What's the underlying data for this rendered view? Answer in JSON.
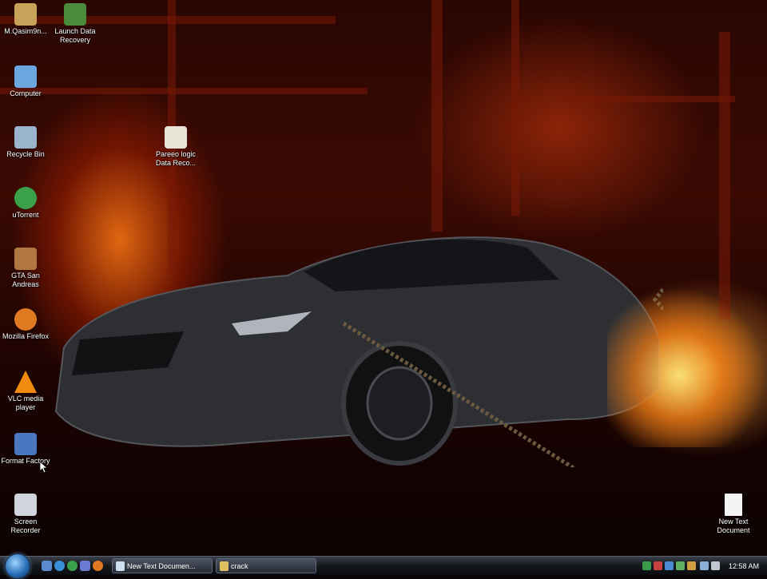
{
  "desktop": {
    "icons": [
      {
        "label": "M.Qasim9n...",
        "icon": "folder-icon",
        "color": "#c8a45a"
      },
      {
        "label": "Launch Data Recovery",
        "icon": "recovery-icon",
        "color": "#4a8a3a"
      },
      {
        "label": "Computer",
        "icon": "computer-icon",
        "color": "#6aa6e0"
      },
      {
        "label": "Recycle Bin",
        "icon": "recycle-bin-icon",
        "color": "#9ab4cc"
      },
      {
        "label": "Pareeo logic Data Reco...",
        "icon": "document-icon",
        "color": "#e8e4d8"
      },
      {
        "label": "uTorrent",
        "icon": "utorrent-icon",
        "color": "#3aa04a"
      },
      {
        "label": "GTA San Andreas",
        "icon": "gta-icon",
        "color": "#b07840"
      },
      {
        "label": "Mozilla Firefox",
        "icon": "firefox-icon",
        "color": "#e07a20"
      },
      {
        "label": "VLC media player",
        "icon": "vlc-icon",
        "color": "#f08a10"
      },
      {
        "label": "Format Factory",
        "icon": "format-factory-icon",
        "color": "#4a78c0"
      },
      {
        "label": "Screen Recorder",
        "icon": "screen-recorder-icon",
        "color": "#d0d4dc"
      },
      {
        "label": "New Text Document",
        "icon": "text-document-icon",
        "color": "#f4f4f4"
      }
    ]
  },
  "taskbar": {
    "quick_launch": [
      {
        "icon": "show-desktop-icon",
        "color": "#5a8ad0"
      },
      {
        "icon": "ie-icon",
        "color": "#3a90d8"
      },
      {
        "icon": "utorrent-icon",
        "color": "#3aa04a"
      },
      {
        "icon": "media-icon",
        "color": "#6a7ad0"
      },
      {
        "icon": "firefox-icon",
        "color": "#e07a20"
      }
    ],
    "tasks": [
      {
        "label": "New Text Documen...",
        "icon": "notepad-icon",
        "color": "#cfe0f0"
      },
      {
        "label": "crack",
        "icon": "folder-icon",
        "color": "#e0c060"
      }
    ],
    "tray": [
      {
        "icon": "tray-app-1-icon",
        "color": "#3a9a4a"
      },
      {
        "icon": "tray-app-2-icon",
        "color": "#c84040"
      },
      {
        "icon": "tray-app-3-icon",
        "color": "#4a8ad0"
      },
      {
        "icon": "tray-app-4-icon",
        "color": "#60b060"
      },
      {
        "icon": "tray-app-5-icon",
        "color": "#d0a040"
      },
      {
        "icon": "network-icon",
        "color": "#8ab0d8"
      },
      {
        "icon": "volume-icon",
        "color": "#c0c8d4"
      }
    ],
    "clock": "12:58 AM"
  }
}
